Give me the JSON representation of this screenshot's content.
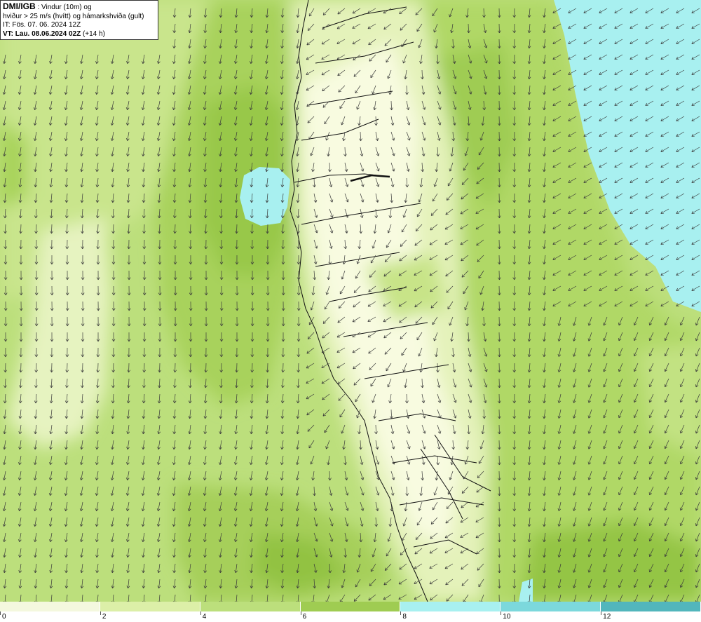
{
  "header": {
    "source": "DMI/IGB",
    "line1_suffix": " : Vindur (10m) og",
    "line2": "hviður > 25 m/s (hvítt) og hámarkshviða (gult)",
    "line3": "IT: Fös. 07. 06. 2024 12Z",
    "line4_bold": "VT: Lau. 08.06.2024 02Z",
    "line4_suffix": " (+14 h)"
  },
  "legend": {
    "labels": [
      "0",
      "2",
      "4",
      "6",
      "8",
      "10",
      "12"
    ],
    "colors": [
      "#f4f8de",
      "#dcefa8",
      "#bcdf7c",
      "#9fcc52",
      "#a8f0f0",
      "#7cd8dc",
      "#52b6bc"
    ]
  },
  "map": {
    "wind_arrow_icon": "arrow-icon",
    "coastline_color": "#000000",
    "land_palette": [
      "#fbfde9",
      "#e8f4c0",
      "#d2eb98",
      "#b8dc74"
    ]
  }
}
